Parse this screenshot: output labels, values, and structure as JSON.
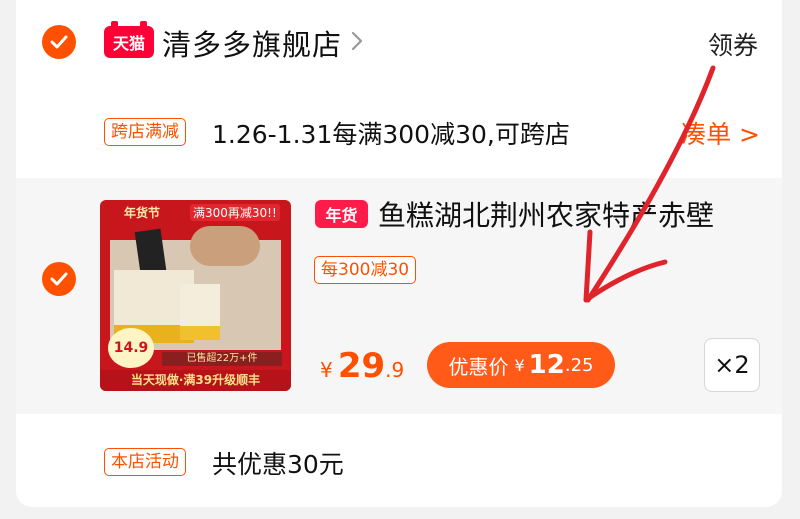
{
  "store": {
    "logo_text": "天猫",
    "name": "清多多旗舰店",
    "coupon_label": "领券"
  },
  "promo": {
    "tag": "跨店满减",
    "text": "1.26-1.31每满300减30,可跨店",
    "link": "凑单 >"
  },
  "item": {
    "tag_new_year": "年货",
    "title": "鱼糕湖北荆州农家特产赤壁",
    "discount_tag": "每300减30",
    "price_currency": "¥",
    "price_int": "29",
    "price_dec": ".9",
    "discount_label": "优惠价",
    "discount_currency": "¥",
    "discount_int": "12",
    "discount_dec": ".25",
    "quantity": "×2",
    "image_text": {
      "festival": "年货节",
      "promo": "满300再减30!!",
      "price": "14.9",
      "sold": "已售超22万+件",
      "banner": "当天现做·满39升级顺丰"
    }
  },
  "activity": {
    "tag": "本店活动",
    "text": "共优惠30元"
  },
  "colors": {
    "accent": "#ff5000",
    "tmall": "#ff0036",
    "annotation_arrow": "#e0242b"
  },
  "icons": {
    "store_check": "check-circle-icon",
    "item_check": "check-circle-icon",
    "store_chevron": "chevron-right-icon"
  }
}
